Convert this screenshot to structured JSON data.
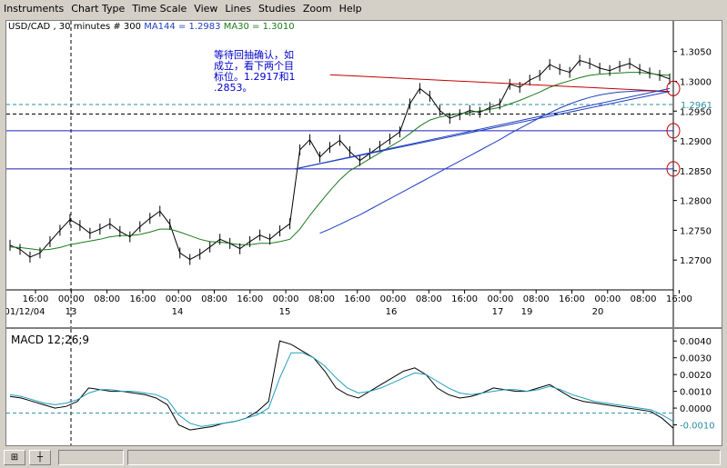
{
  "menu": [
    "Instruments",
    "Chart Type",
    "Time Scale",
    "View",
    "Lines",
    "Studies",
    "Zoom",
    "Help"
  ],
  "header": {
    "symbol": "USD/CAD , 30 minutes # 300",
    "ma144": "MA144 = 1.2983",
    "ma30": "MA30 = 1.3010"
  },
  "annotation": "等待回抽确认，如\n成立，看下两个目\n标位。1.2917和1\n.2853。",
  "chart_data": [
    {
      "type": "line",
      "name": "price",
      "ylim": [
        1.265,
        1.308
      ],
      "yticks": [
        "1.3050",
        "1.3000",
        "1.2950",
        "1.2900",
        "1.2850",
        "1.2800",
        "1.2750",
        "1.2700"
      ],
      "ytick_values": [
        1.305,
        1.3,
        1.295,
        1.29,
        1.285,
        1.28,
        1.275,
        1.27
      ],
      "price_label": "1.2961",
      "price_label_value": 1.2961,
      "horizontal_levels": [
        1.2917,
        1.2853
      ],
      "dashed_levels": [
        1.2961,
        1.2945
      ],
      "xticks": [
        "16:00",
        "00:00",
        "08:00",
        "16:00",
        "00:00",
        "08:00",
        "16:00",
        "00:00",
        "08:00",
        "16:00",
        "00:00",
        "08:00",
        "16:00",
        "00:00",
        "08:00",
        "16:00",
        "00:00",
        "08:00",
        "16:00"
      ],
      "date_labels": [
        "01/12/04",
        "13",
        "14",
        "15",
        "16",
        "17",
        "19",
        "20"
      ],
      "series": [
        {
          "name": "price",
          "color": "#000000",
          "values": [
            1.2725,
            1.2718,
            1.2705,
            1.2712,
            1.2731,
            1.275,
            1.2768,
            1.2758,
            1.2745,
            1.2752,
            1.2761,
            1.2748,
            1.2739,
            1.2756,
            1.277,
            1.2782,
            1.276,
            1.2712,
            1.2701,
            1.271,
            1.2722,
            1.2735,
            1.2728,
            1.2719,
            1.2731,
            1.2742,
            1.2735,
            1.2749,
            1.2761,
            1.2885,
            1.2902,
            1.2873,
            1.2889,
            1.2901,
            1.2882,
            1.2867,
            1.2879,
            1.2891,
            1.2903,
            1.2915,
            1.2962,
            1.2988,
            1.2975,
            1.2951,
            1.2938,
            1.2944,
            1.2951,
            1.2948,
            1.2956,
            1.2962,
            1.2995,
            1.299,
            1.3002,
            1.301,
            1.3028,
            1.302,
            1.3015,
            1.3035,
            1.303,
            1.3022,
            1.3018,
            1.3025,
            1.303,
            1.302,
            1.3014,
            1.301,
            1.3004
          ]
        },
        {
          "name": "MA30",
          "color": "#1a7a1a",
          "values": [
            1.2722,
            1.2721,
            1.2719,
            1.2717,
            1.2718,
            1.2721,
            1.2726,
            1.2729,
            1.2732,
            1.2735,
            1.2739,
            1.2741,
            1.2741,
            1.2743,
            1.2747,
            1.2752,
            1.2752,
            1.2747,
            1.2741,
            1.2735,
            1.2731,
            1.273,
            1.2728,
            1.2726,
            1.2726,
            1.2728,
            1.2728,
            1.2731,
            1.2735,
            1.2752,
            1.2775,
            1.2796,
            1.2816,
            1.2835,
            1.285,
            1.286,
            1.287,
            1.288,
            1.289,
            1.29,
            1.2912,
            1.2925,
            1.2935,
            1.294,
            1.2943,
            1.2946,
            1.2948,
            1.295,
            1.2953,
            1.2956,
            1.2962,
            1.2968,
            1.2975,
            1.2982,
            1.299,
            1.2996,
            1.3001,
            1.3006,
            1.301,
            1.3012,
            1.3013,
            1.3014,
            1.3015,
            1.3015,
            1.3013,
            1.3011,
            1.301
          ]
        },
        {
          "name": "MA144",
          "color": "#1f3fbf",
          "values": [
            null,
            null,
            null,
            null,
            null,
            null,
            null,
            null,
            null,
            null,
            null,
            null,
            null,
            null,
            null,
            null,
            null,
            null,
            null,
            null,
            null,
            null,
            null,
            null,
            null,
            null,
            null,
            null,
            null,
            null,
            null,
            1.2745,
            1.2752,
            1.276,
            1.2768,
            1.2776,
            1.2785,
            1.2794,
            1.2803,
            1.2812,
            1.2821,
            1.283,
            1.2839,
            1.2848,
            1.2857,
            1.2866,
            1.2875,
            1.2884,
            1.2893,
            1.2902,
            1.2912,
            1.2921,
            1.293,
            1.2939,
            1.2947,
            1.2955,
            1.2962,
            1.2968,
            1.2973,
            1.2977,
            1.298,
            1.2982,
            1.2983,
            1.2984,
            1.2984,
            1.2983,
            1.2983
          ]
        }
      ],
      "trendlines": [
        {
          "color": "#c00000",
          "from": [
            48.5,
            1.3011
          ],
          "to": [
            100,
            1.2983
          ]
        },
        {
          "color": "#1f3fbf",
          "from": [
            43.2,
            1.2853
          ],
          "to": [
            100,
            1.2983
          ]
        },
        {
          "color": "#1f3fbf",
          "from": [
            43.2,
            1.2853
          ],
          "to": [
            100,
            1.2988
          ]
        }
      ],
      "circles": [
        [
          100,
          1.2988
        ],
        [
          100,
          1.2917
        ],
        [
          100,
          1.2853
        ]
      ]
    },
    {
      "type": "line",
      "name": "MACD 12;26;9",
      "title": "MACD 12;26;9",
      "ylim": [
        -0.002,
        0.0045
      ],
      "yticks": [
        "0.0040",
        "0.0030",
        "0.0020",
        "0.0010",
        "0.0000",
        "-0.0010"
      ],
      "ytick_values": [
        0.004,
        0.003,
        0.002,
        0.001,
        0.0,
        -0.001
      ],
      "dashed_level": -0.0003,
      "series": [
        {
          "name": "MACD",
          "color": "#000000",
          "values": [
            0.0007,
            0.0006,
            0.0004,
            0.0002,
            0.0,
            0.0001,
            0.0004,
            0.0012,
            0.0011,
            0.001,
            0.001,
            0.0009,
            0.0008,
            0.0006,
            0.0002,
            -0.001,
            -0.0013,
            -0.0012,
            -0.0011,
            -0.0009,
            -0.0008,
            -0.0006,
            -0.0002,
            0.0004,
            0.004,
            0.0038,
            0.0034,
            0.003,
            0.0022,
            0.0012,
            0.0008,
            0.0006,
            0.001,
            0.0014,
            0.0018,
            0.0022,
            0.0024,
            0.002,
            0.0012,
            0.0008,
            0.0006,
            0.0007,
            0.0009,
            0.0012,
            0.0011,
            0.001,
            0.001,
            0.0012,
            0.0014,
            0.001,
            0.0006,
            0.0004,
            0.0003,
            0.0002,
            0.0001,
            0.0,
            -0.0001,
            -0.0002,
            -0.0006,
            -0.0012
          ]
        },
        {
          "name": "Signal",
          "color": "#1f9fbf",
          "values": [
            0.0008,
            0.0007,
            0.0005,
            0.0003,
            0.0002,
            0.0003,
            0.0005,
            0.0009,
            0.0011,
            0.0011,
            0.001,
            0.001,
            0.0009,
            0.0008,
            0.0005,
            -0.0004,
            -0.0009,
            -0.0011,
            -0.001,
            -0.0009,
            -0.0008,
            -0.0006,
            -0.0004,
            0.0,
            0.0018,
            0.0033,
            0.0033,
            0.003,
            0.0025,
            0.0018,
            0.0012,
            0.0009,
            0.001,
            0.0012,
            0.0015,
            0.0018,
            0.0021,
            0.002,
            0.0016,
            0.0012,
            0.0009,
            0.0008,
            0.0009,
            0.001,
            0.0011,
            0.0011,
            0.001,
            0.0011,
            0.0013,
            0.0011,
            0.0008,
            0.0006,
            0.0004,
            0.0003,
            0.0002,
            0.0001,
            0.0,
            -0.0001,
            -0.0004,
            -0.0008
          ]
        }
      ]
    }
  ]
}
